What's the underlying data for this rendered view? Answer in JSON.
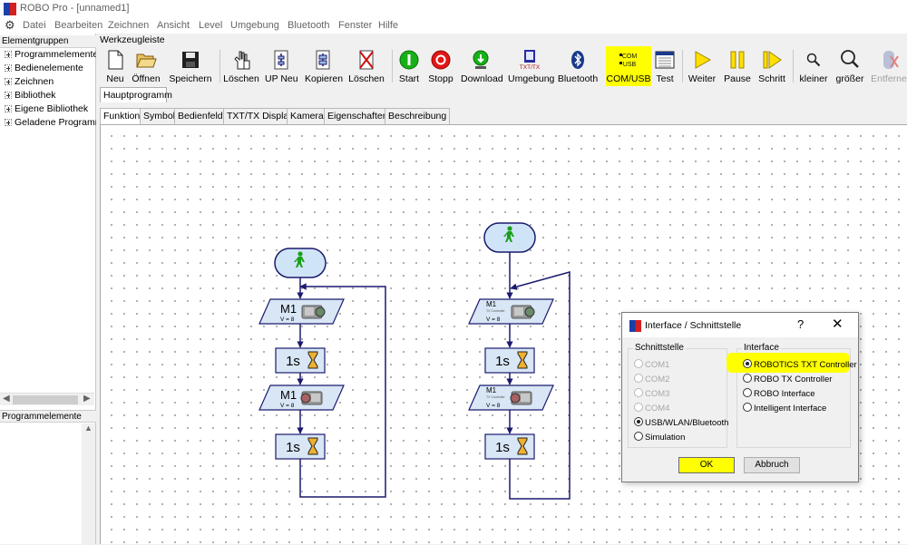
{
  "window": {
    "title": "ROBO Pro - [unnamed1]"
  },
  "menu": [
    "Datei",
    "Bearbeiten",
    "Zeichnen",
    "Ansicht",
    "Level",
    "Umgebung",
    "Bluetooth",
    "Fenster",
    "Hilfe"
  ],
  "left_panel": {
    "header": "Elementgruppen",
    "items": [
      "Programmelemente",
      "Bedienelemente",
      "Zeichnen",
      "Bibliothek",
      "Eigene Bibliothek",
      "Geladene Programme"
    ],
    "bottom_header": "Programmelemente"
  },
  "toolbar": {
    "header": "Werkzeugleiste",
    "buttons": [
      {
        "label": "Neu",
        "icon": "new-file-icon"
      },
      {
        "label": "Öffnen",
        "icon": "open-folder-icon"
      },
      {
        "label": "Speichern",
        "icon": "save-disk-icon"
      },
      {
        "label": "Löschen",
        "icon": "delete-hand-icon"
      },
      {
        "label": "UP Neu",
        "icon": "new-subprogram-icon"
      },
      {
        "label": "Kopieren",
        "icon": "copy-icon"
      },
      {
        "label": "Löschen",
        "icon": "delete-x-icon"
      },
      {
        "label": "Start",
        "icon": "start-icon"
      },
      {
        "label": "Stopp",
        "icon": "stop-icon"
      },
      {
        "label": "Download",
        "icon": "download-icon"
      },
      {
        "label": "Umgebung",
        "icon": "environment-icon"
      },
      {
        "label": "Bluetooth",
        "icon": "bluetooth-icon"
      },
      {
        "label": "COM/USB",
        "icon": "com-usb-icon"
      },
      {
        "label": "Test",
        "icon": "test-icon"
      },
      {
        "label": "Weiter",
        "icon": "continue-icon"
      },
      {
        "label": "Pause",
        "icon": "pause-icon"
      },
      {
        "label": "Schritt",
        "icon": "step-icon"
      },
      {
        "label": "kleiner",
        "icon": "zoom-out-icon"
      },
      {
        "label": "größer",
        "icon": "zoom-in-icon"
      },
      {
        "label": "Entferne",
        "icon": "remove-icon"
      }
    ],
    "icon_text": {
      "umgebung": "TXT/TX",
      "com_top": "COM",
      "com_bottom": "USB"
    }
  },
  "tabs": {
    "main": "Hauptprogramm",
    "sub": [
      "Funktion",
      "Symbol",
      "Bedienfeld",
      "TXT/TX Display",
      "Kamera",
      "Eigenschaften",
      "Beschreibung"
    ]
  },
  "flowchart": {
    "motor_label": "M1",
    "motor_speed": "V = 8",
    "motor_sub": "TX Controller",
    "delay": "1s"
  },
  "dialog": {
    "title": "Interface / Schnittstelle",
    "help": "?",
    "close": "✕",
    "port_group": "Schnittstelle",
    "ports": [
      {
        "label": "COM1",
        "enabled": false,
        "selected": false
      },
      {
        "label": "COM2",
        "enabled": false,
        "selected": false
      },
      {
        "label": "COM3",
        "enabled": false,
        "selected": false
      },
      {
        "label": "COM4",
        "enabled": false,
        "selected": false
      },
      {
        "label": "USB/WLAN/Bluetooth",
        "enabled": true,
        "selected": true
      },
      {
        "label": "Simulation",
        "enabled": true,
        "selected": false
      }
    ],
    "iface_group": "Interface",
    "interfaces": [
      {
        "label": "ROBOTICS TXT Controller",
        "selected": true
      },
      {
        "label": "ROBO TX Controller",
        "selected": false
      },
      {
        "label": "ROBO Interface",
        "selected": false
      },
      {
        "label": "Intelligent Interface",
        "selected": false
      }
    ],
    "ok": "OK",
    "cancel": "Abbruch"
  },
  "colors": {
    "highlight": "#ffff00",
    "flow_line": "#1a1a6e",
    "block_fill": "#d8e6f5",
    "start_fill": "#d0e4f7"
  }
}
